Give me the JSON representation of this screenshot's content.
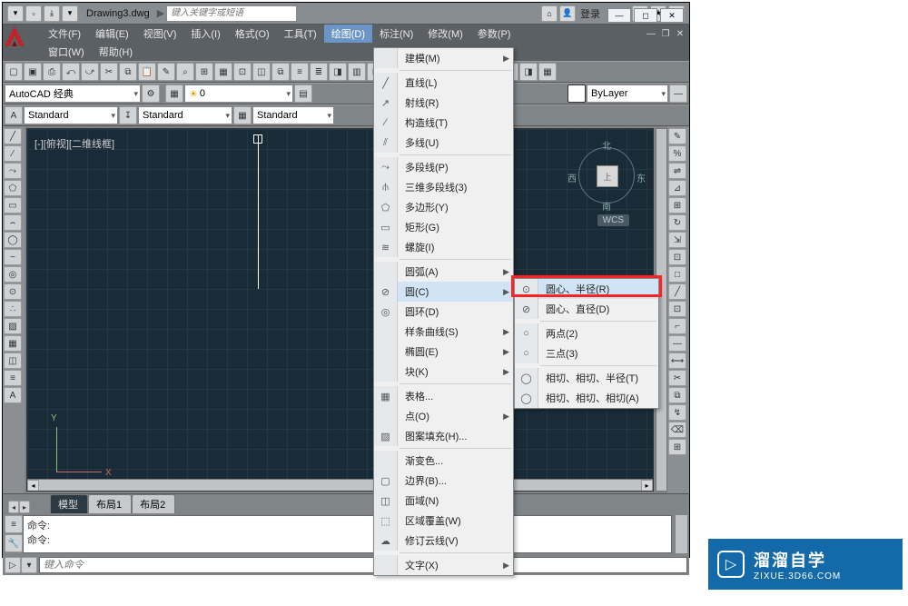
{
  "title_bar": {
    "filename": "Drawing3.dwg",
    "search_placeholder": "键入关键字或短语",
    "login": "登录"
  },
  "menu": {
    "items": [
      {
        "label": "文件(F)"
      },
      {
        "label": "编辑(E)"
      },
      {
        "label": "视图(V)"
      },
      {
        "label": "插入(I)"
      },
      {
        "label": "格式(O)"
      },
      {
        "label": "工具(T)"
      },
      {
        "label": "绘图(D)",
        "active": true
      },
      {
        "label": "标注(N)"
      },
      {
        "label": "修改(M)"
      },
      {
        "label": "参数(P)"
      }
    ],
    "items2": [
      {
        "label": "窗口(W)"
      },
      {
        "label": "帮助(H)"
      }
    ]
  },
  "combos": {
    "workspace": "AutoCAD 经典",
    "layer": "0",
    "textstyle1": "Standard",
    "textstyle2": "Standard",
    "textstyle3": "Standard",
    "bylayer": "ByLayer"
  },
  "viewport": {
    "label": "[-][俯视][二维线框]",
    "y": "Y",
    "x": "X",
    "wcs": "WCS",
    "nav_top": "上",
    "n": "北",
    "s": "南",
    "w": "西",
    "e": "东"
  },
  "tabs": {
    "nav_l": "◂",
    "nav_r": "▸",
    "items": [
      {
        "label": "模型",
        "active": true
      },
      {
        "label": "布局1"
      },
      {
        "label": "布局2"
      }
    ]
  },
  "cmd": {
    "history": "命令:\n命令:",
    "placeholder": "键入命令"
  },
  "draw_menu": [
    {
      "label": "建模(M)",
      "arrow": true
    },
    {
      "sep": true
    },
    {
      "label": "直线(L)",
      "icon": "╱"
    },
    {
      "label": "射线(R)",
      "icon": "↗"
    },
    {
      "label": "构造线(T)",
      "icon": "∕"
    },
    {
      "label": "多线(U)",
      "icon": "⫽"
    },
    {
      "sep": true
    },
    {
      "label": "多段线(P)",
      "icon": "⤳"
    },
    {
      "label": "三维多段线(3)",
      "icon": "⫛"
    },
    {
      "label": "多边形(Y)",
      "icon": "⬠"
    },
    {
      "label": "矩形(G)",
      "icon": "▭"
    },
    {
      "label": "螺旋(I)",
      "icon": "≋"
    },
    {
      "sep": true
    },
    {
      "label": "圆弧(A)",
      "arrow": true
    },
    {
      "label": "圆(C)",
      "arrow": true,
      "hl": true,
      "icon": "⊘"
    },
    {
      "label": "圆环(D)",
      "icon": "◎"
    },
    {
      "label": "样条曲线(S)",
      "arrow": true
    },
    {
      "label": "椭圆(E)",
      "arrow": true
    },
    {
      "label": "块(K)",
      "arrow": true
    },
    {
      "sep": true
    },
    {
      "label": "表格...",
      "icon": "▦"
    },
    {
      "label": "点(O)",
      "arrow": true
    },
    {
      "label": "图案填充(H)...",
      "icon": "▨"
    },
    {
      "sep": true
    },
    {
      "label": "渐变色..."
    },
    {
      "label": "边界(B)...",
      "icon": "▢"
    },
    {
      "label": "面域(N)",
      "icon": "◫"
    },
    {
      "label": "区域覆盖(W)",
      "icon": "⬚"
    },
    {
      "label": "修订云线(V)",
      "icon": "☁"
    },
    {
      "sep": true
    },
    {
      "label": "文字(X)",
      "arrow": true
    }
  ],
  "circle_menu": [
    {
      "label": "圆心、半径(R)",
      "icon": "⊙",
      "hl": true
    },
    {
      "label": "圆心、直径(D)",
      "icon": "⊘"
    },
    {
      "sep": true
    },
    {
      "label": "两点(2)",
      "icon": "○"
    },
    {
      "label": "三点(3)",
      "icon": "○"
    },
    {
      "sep": true
    },
    {
      "label": "相切、相切、半径(T)",
      "icon": "◯"
    },
    {
      "label": "相切、相切、相切(A)",
      "icon": "◯"
    }
  ],
  "brand": {
    "cn": "溜溜自学",
    "url": "ZIXUE.3D66.COM"
  },
  "left_tool_icons": [
    "╱",
    "∕",
    "⤳",
    "⬠",
    "▭",
    "⌢",
    "◯",
    "~",
    "◎",
    "⊙",
    "∴",
    "▨",
    "▦",
    "◫",
    "≡",
    "A"
  ],
  "right_tool_icons": [
    "✎",
    "%",
    "⇌",
    "⊿",
    "⊞",
    "↻",
    "⇲",
    "⊡",
    "□",
    "╱",
    "⊡",
    "⌐",
    "—",
    "⟷",
    "✂",
    "⧉",
    "↯",
    "⌫",
    "⊞"
  ],
  "tb1_icons": [
    "▢",
    "▣",
    "⎙",
    "⤺",
    "⤻",
    "✂",
    "⧉",
    "📋",
    "✎",
    "⌕",
    "⊞",
    "▦",
    "⊡",
    "◫",
    "⧉",
    "≡",
    "≣",
    "◨",
    "▥",
    "⊡",
    "⬚",
    "▤",
    "⊡",
    "⎘",
    "?",
    "▭",
    "◫",
    "◨",
    "▦"
  ],
  "tb3_icons": [
    "A",
    "↧"
  ]
}
